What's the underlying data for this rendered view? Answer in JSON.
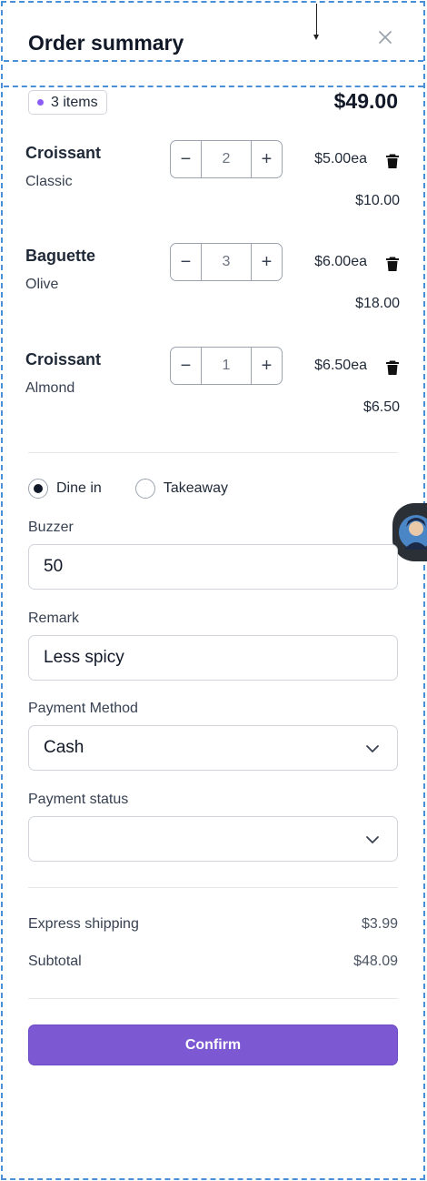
{
  "header": {
    "title": "Order summary"
  },
  "summary_badge": {
    "count_label": "3 items"
  },
  "order_total": "$49.00",
  "items": [
    {
      "name": "Croissant",
      "variant": "Classic",
      "qty": "2",
      "unit_price": "$5.00ea",
      "line_total": "$10.00"
    },
    {
      "name": "Baguette",
      "variant": "Olive",
      "qty": "3",
      "unit_price": "$6.00ea",
      "line_total": "$18.00"
    },
    {
      "name": "Croissant",
      "variant": "Almond",
      "qty": "1",
      "unit_price": "$6.50ea",
      "line_total": "$6.50"
    }
  ],
  "stepper": {
    "minus": "−",
    "plus": "+"
  },
  "dining": {
    "options": [
      "Dine in",
      "Takeaway"
    ],
    "selected": "Dine in"
  },
  "form": {
    "buzzer": {
      "label": "Buzzer",
      "value": "50"
    },
    "remark": {
      "label": "Remark",
      "value": "Less spicy"
    },
    "payment_method": {
      "label": "Payment Method",
      "value": "Cash"
    },
    "payment_status": {
      "label": "Payment status",
      "value": ""
    }
  },
  "totals": {
    "shipping": {
      "label": "Express shipping",
      "value": "$3.99"
    },
    "subtotal": {
      "label": "Subtotal",
      "value": "$48.09"
    }
  },
  "actions": {
    "confirm_label": "Confirm"
  },
  "colors": {
    "accent": "#7c58d3",
    "badge_dot": "#8b5cf6",
    "frame_dash": "#4a90d9"
  }
}
